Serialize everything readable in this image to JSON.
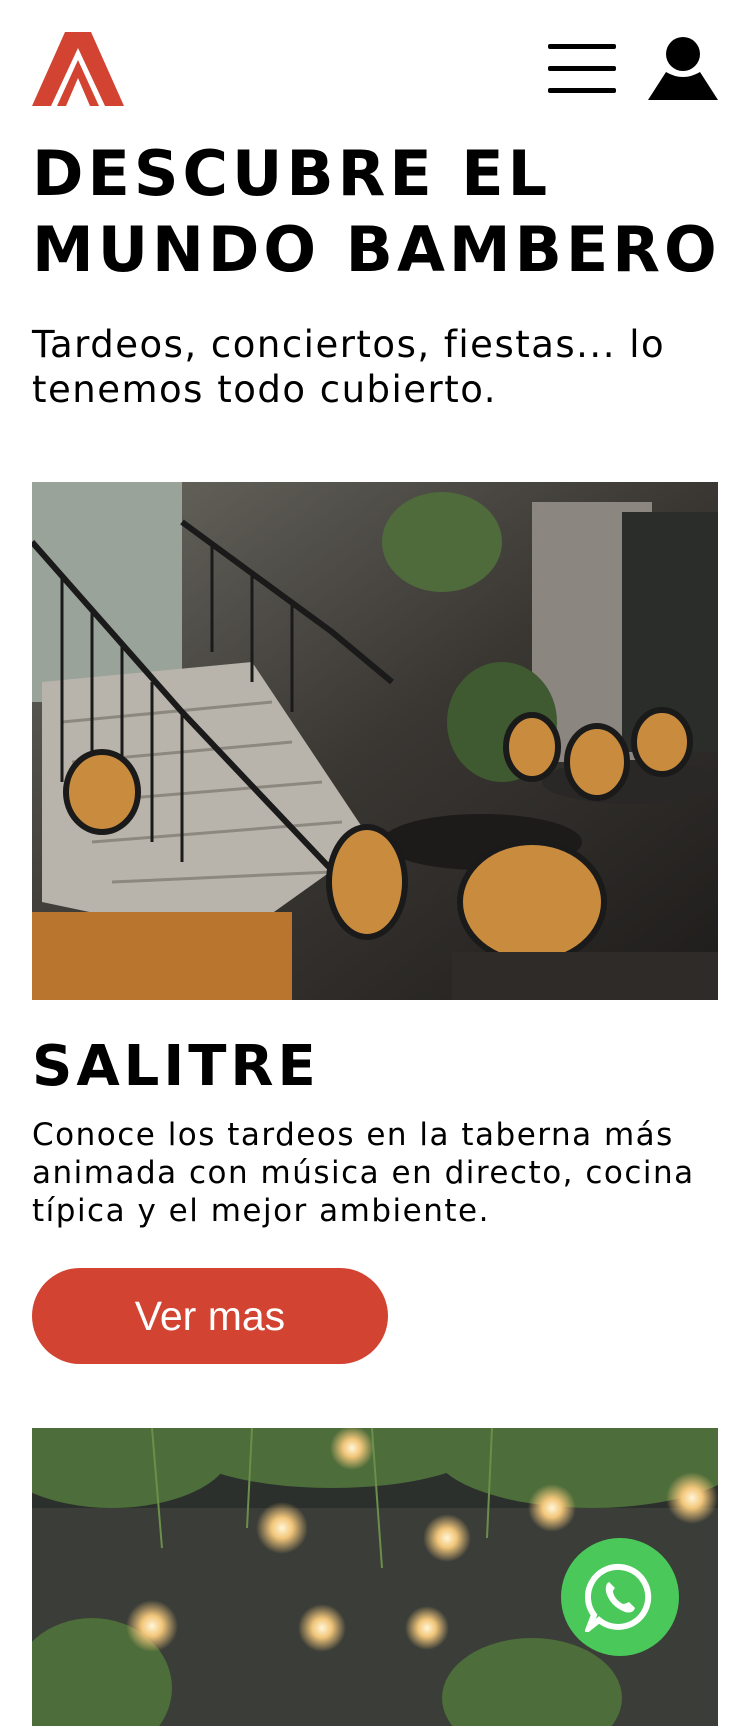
{
  "header": {
    "logo_icon": "bambero-logo-icon",
    "menu_icon": "hamburger-menu-icon",
    "user_icon": "user-account-icon"
  },
  "hero": {
    "title_line1": "DESCUBRE EL",
    "title_line2": "MUNDO BAMBERO",
    "subtitle_line1": "Tardeos, conciertos, fiestas... lo",
    "subtitle_line2": "tenemos todo cubierto."
  },
  "venues": [
    {
      "name": "SALITRE",
      "description_line1": "Conoce los tardeos en la taberna más",
      "description_line2": "animada con música en directo, cocina",
      "description_line3": "típica y el mejor ambiente.",
      "button_label": "Ver mas"
    }
  ],
  "floating": {
    "whatsapp_icon": "whatsapp-icon"
  },
  "colors": {
    "brand": "#d24331",
    "whatsapp": "#4ac95a",
    "text": "#000000"
  }
}
